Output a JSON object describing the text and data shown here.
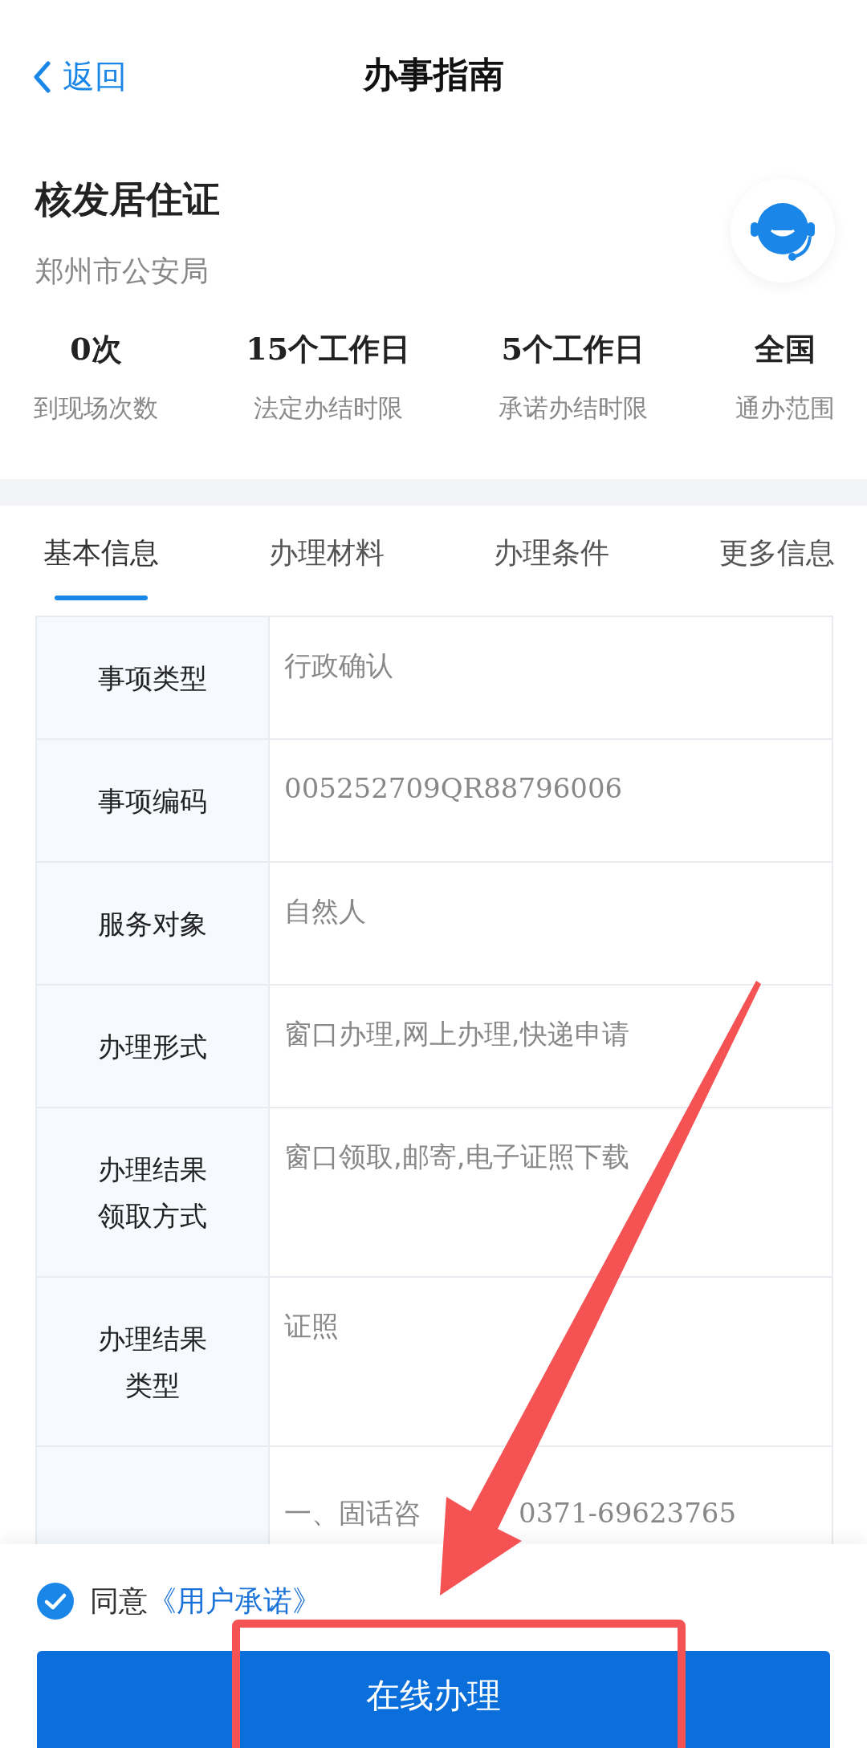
{
  "nav": {
    "back": "返回",
    "title": "办事指南"
  },
  "service": {
    "name": "核发居住证",
    "department": "郑州市公安局"
  },
  "stats": [
    {
      "value": "0次",
      "label": "到现场次数"
    },
    {
      "value": "15个工作日",
      "label": "法定办结时限"
    },
    {
      "value": "5个工作日",
      "label": "承诺办结时限"
    },
    {
      "value": "全国",
      "label": "通办范围"
    }
  ],
  "tabs": [
    {
      "label": "基本信息",
      "selected": true
    },
    {
      "label": "办理材料",
      "selected": false
    },
    {
      "label": "办理条件",
      "selected": false
    },
    {
      "label": "更多信息",
      "selected": false
    }
  ],
  "table": {
    "rows": [
      {
        "label": "事项类型",
        "value": "行政确认"
      },
      {
        "label": "事项编码",
        "value": "005252709QR88796006"
      },
      {
        "label": "服务对象",
        "value": "自然人"
      },
      {
        "label": "办理形式",
        "value": "窗口办理,网上办理,快递申请"
      },
      {
        "label": "办理结果领取方式",
        "value": "窗口领取,邮寄,电子证照下载"
      },
      {
        "label": "办理结果类型",
        "value": "证照"
      },
      {
        "label": "",
        "value_parts": [
          "一、固话咨",
          "0371-69623765"
        ]
      }
    ]
  },
  "footer": {
    "agree_checked": true,
    "agree": "同意",
    "agreement_link": "《用户承诺》",
    "button": "在线办理"
  }
}
